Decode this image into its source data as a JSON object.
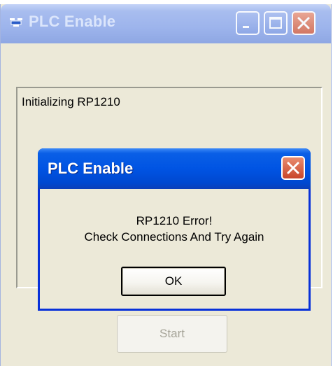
{
  "main_window": {
    "title": "PLC Enable",
    "icon": "plc-app-icon",
    "caption_buttons": [
      "minimize-icon",
      "maximize-icon",
      "close-icon"
    ],
    "status_text": "Initializing RP1210",
    "start_button_label": "Start",
    "start_button_enabled": false,
    "active": false
  },
  "dialog": {
    "title": "PLC Enable",
    "message_line1": "RP1210 Error!",
    "message_line2": "Check Connections And Try Again",
    "ok_label": "OK",
    "close_icon": "close-icon",
    "active": true
  },
  "colors": {
    "dialog_title_blue": "#0054e3",
    "inactive_title_blue": "#9db4ec",
    "close_red": "#d7735a",
    "window_face": "#ece9d8",
    "disabled_text": "#a6a498"
  }
}
